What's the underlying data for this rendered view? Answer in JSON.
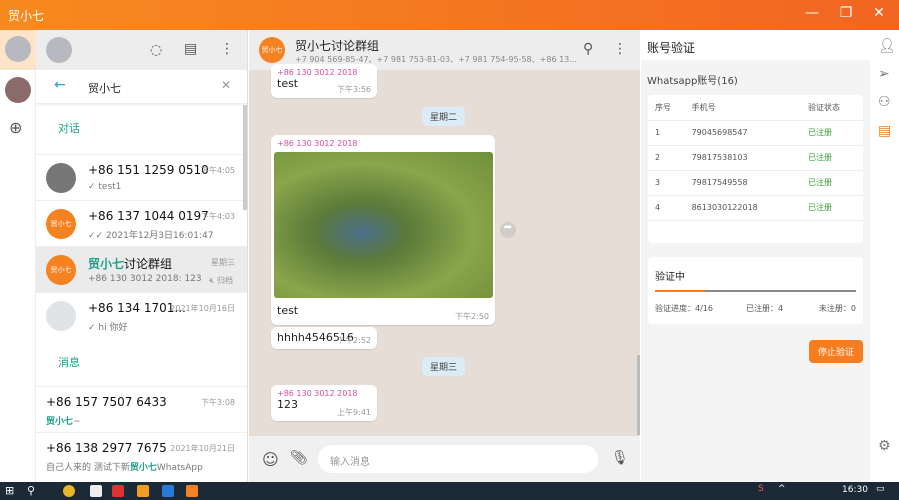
{
  "window": {
    "title": "贸小七",
    "minimize_icon": "minimize-icon",
    "maximize_icon": "restore-icon",
    "close_icon": "close-icon"
  },
  "sidebar": {
    "search_value": "贸小七",
    "section_chats": "对话",
    "section_messages": "消息",
    "chats": [
      {
        "name": "+86 151 1259 0510",
        "sub": "✓ test1",
        "time": "下午4:05"
      },
      {
        "name": "+86 137 1044 0197",
        "sub": "✓✓ 2021年12月3日16:01:47",
        "time": "下午4:03",
        "avatar": "贸小七"
      },
      {
        "name_hl": "贸小七",
        "name_rest": "讨论群组",
        "sub": "+86 130 3012 2018: 123",
        "time": "星期三",
        "badge": "归档",
        "avatar": "贸小七"
      },
      {
        "name": "+86 134 1701...",
        "sub": "✓ hi 你好",
        "time": "2021年10月16日"
      }
    ],
    "messages": [
      {
        "name": "+86 157 7507 6433",
        "sub_hl": "贸小七",
        "sub_rest": "~",
        "time": "下午3:08"
      },
      {
        "name": "+86 138 2977 7675",
        "sub_pre": "自己人来的 测试下新",
        "sub_hl": "贸小七",
        "sub_rest": "WhatsApp",
        "time": "2021年10月21日"
      }
    ]
  },
  "chat": {
    "title": "贸小七讨论群组",
    "members": "+7 904 569-85-47、+7 981 753-81-03、+7 981 754-95-58、+86 13...",
    "messages": [
      {
        "sender": "+86 130 3012 2018",
        "text": "test",
        "time": "下午3:56"
      },
      {
        "day": "星期二"
      },
      {
        "sender": "+86 130 3012 2018",
        "text": "test",
        "time": "下午2:50",
        "image": "kingfisher"
      },
      {
        "text": "hhhh4546516",
        "time": "下午2:52"
      },
      {
        "day": "星期三"
      },
      {
        "sender": "+86 130 3012 2018",
        "text": "123",
        "time": "上午9:41"
      }
    ],
    "input_placeholder": "输入消息"
  },
  "verify": {
    "title": "账号验证",
    "account_label": "Whatsapp账号(16)",
    "headers": [
      "序号",
      "手机号",
      "验证状态"
    ],
    "rows": [
      [
        "1",
        "79045698547",
        "已注册"
      ],
      [
        "2",
        "79817538103",
        "已注册"
      ],
      [
        "3",
        "79817549558",
        "已注册"
      ],
      [
        "4",
        "8613030122018",
        "已注册"
      ]
    ],
    "status_title": "验证中",
    "progress_label": "验证进度：4/16",
    "progress": 0.25,
    "registered": "已注册：4",
    "unregistered": "未注册：0",
    "stop_button": "停止验证",
    "accent": "#f57c1f"
  },
  "taskbar": {
    "time": "16:30"
  }
}
